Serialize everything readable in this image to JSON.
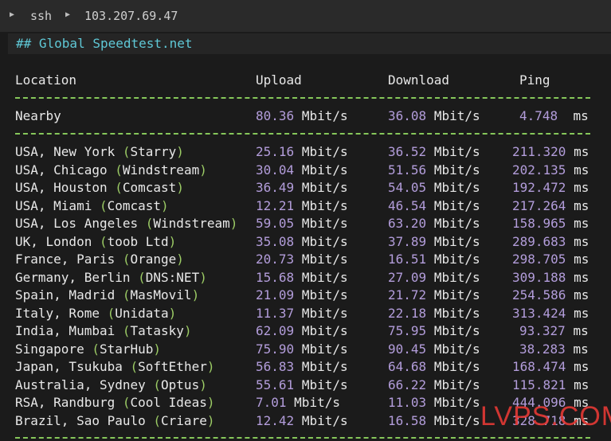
{
  "titlebar": {
    "cmd": "ssh",
    "host": "103.207.69.47"
  },
  "section_title": "## Global Speedtest.net",
  "columns": {
    "location": "Location",
    "upload": "Upload",
    "download": "Download",
    "ping": "Ping"
  },
  "nearby": {
    "name": "Nearby",
    "up": "80.36",
    "down": "36.08",
    "ping": "4.748"
  },
  "units": {
    "speed": "Mbit/s",
    "ping": "ms"
  },
  "servers": [
    {
      "place": "USA, New York ",
      "isp": "Starry",
      "up": "25.16",
      "down": "36.52",
      "ping": "211.320"
    },
    {
      "place": "USA, Chicago ",
      "isp": "Windstream",
      "up": "30.04",
      "down": "51.56",
      "ping": "202.135"
    },
    {
      "place": "USA, Houston ",
      "isp": "Comcast",
      "up": "36.49",
      "down": "54.05",
      "ping": "192.472"
    },
    {
      "place": "USA, Miami ",
      "isp": "Comcast",
      "up": "12.21",
      "down": "46.54",
      "ping": "217.264"
    },
    {
      "place": "USA, Los Angeles ",
      "isp": "Windstream",
      "up": "59.05",
      "down": "63.20",
      "ping": "158.965"
    },
    {
      "place": "UK, London ",
      "isp": "toob Ltd",
      "up": "35.08",
      "down": "37.89",
      "ping": "289.683"
    },
    {
      "place": "France, Paris ",
      "isp": "Orange",
      "up": "20.73",
      "down": "16.51",
      "ping": "298.705"
    },
    {
      "place": "Germany, Berlin ",
      "isp": "DNS:NET",
      "up": "15.68",
      "down": "27.09",
      "ping": "309.188"
    },
    {
      "place": "Spain, Madrid ",
      "isp": "MasMovil",
      "up": "21.09",
      "down": "21.72",
      "ping": "254.586"
    },
    {
      "place": "Italy, Rome ",
      "isp": "Unidata",
      "up": "11.37",
      "down": "22.18",
      "ping": "313.424"
    },
    {
      "place": "India, Mumbai ",
      "isp": "Tatasky",
      "up": "62.09",
      "down": "75.95",
      "ping": "93.327"
    },
    {
      "place": "Singapore ",
      "isp": "StarHub",
      "up": "75.90",
      "down": "90.45",
      "ping": "38.283"
    },
    {
      "place": "Japan, Tsukuba ",
      "isp": "SoftEther",
      "up": "56.83",
      "down": "64.68",
      "ping": "168.474"
    },
    {
      "place": "Australia, Sydney ",
      "isp": "Optus",
      "up": "55.61",
      "down": "66.22",
      "ping": "115.821"
    },
    {
      "place": "RSA, Randburg ",
      "isp": "Cool Ideas",
      "up": "7.01",
      "down": "11.03",
      "ping": "444.096"
    },
    {
      "place": "Brazil, Sao Paulo ",
      "isp": "Criare",
      "up": "12.42",
      "down": "16.58",
      "ping": "328.718"
    }
  ],
  "watermark": "LVPS.COM",
  "colors": {
    "accent_cyan": "#5fc8d6",
    "paren_green": "#9ccc65",
    "number_purple": "#b39ddb",
    "dash_green": "#86c75a",
    "watermark_red": "#e53935"
  }
}
